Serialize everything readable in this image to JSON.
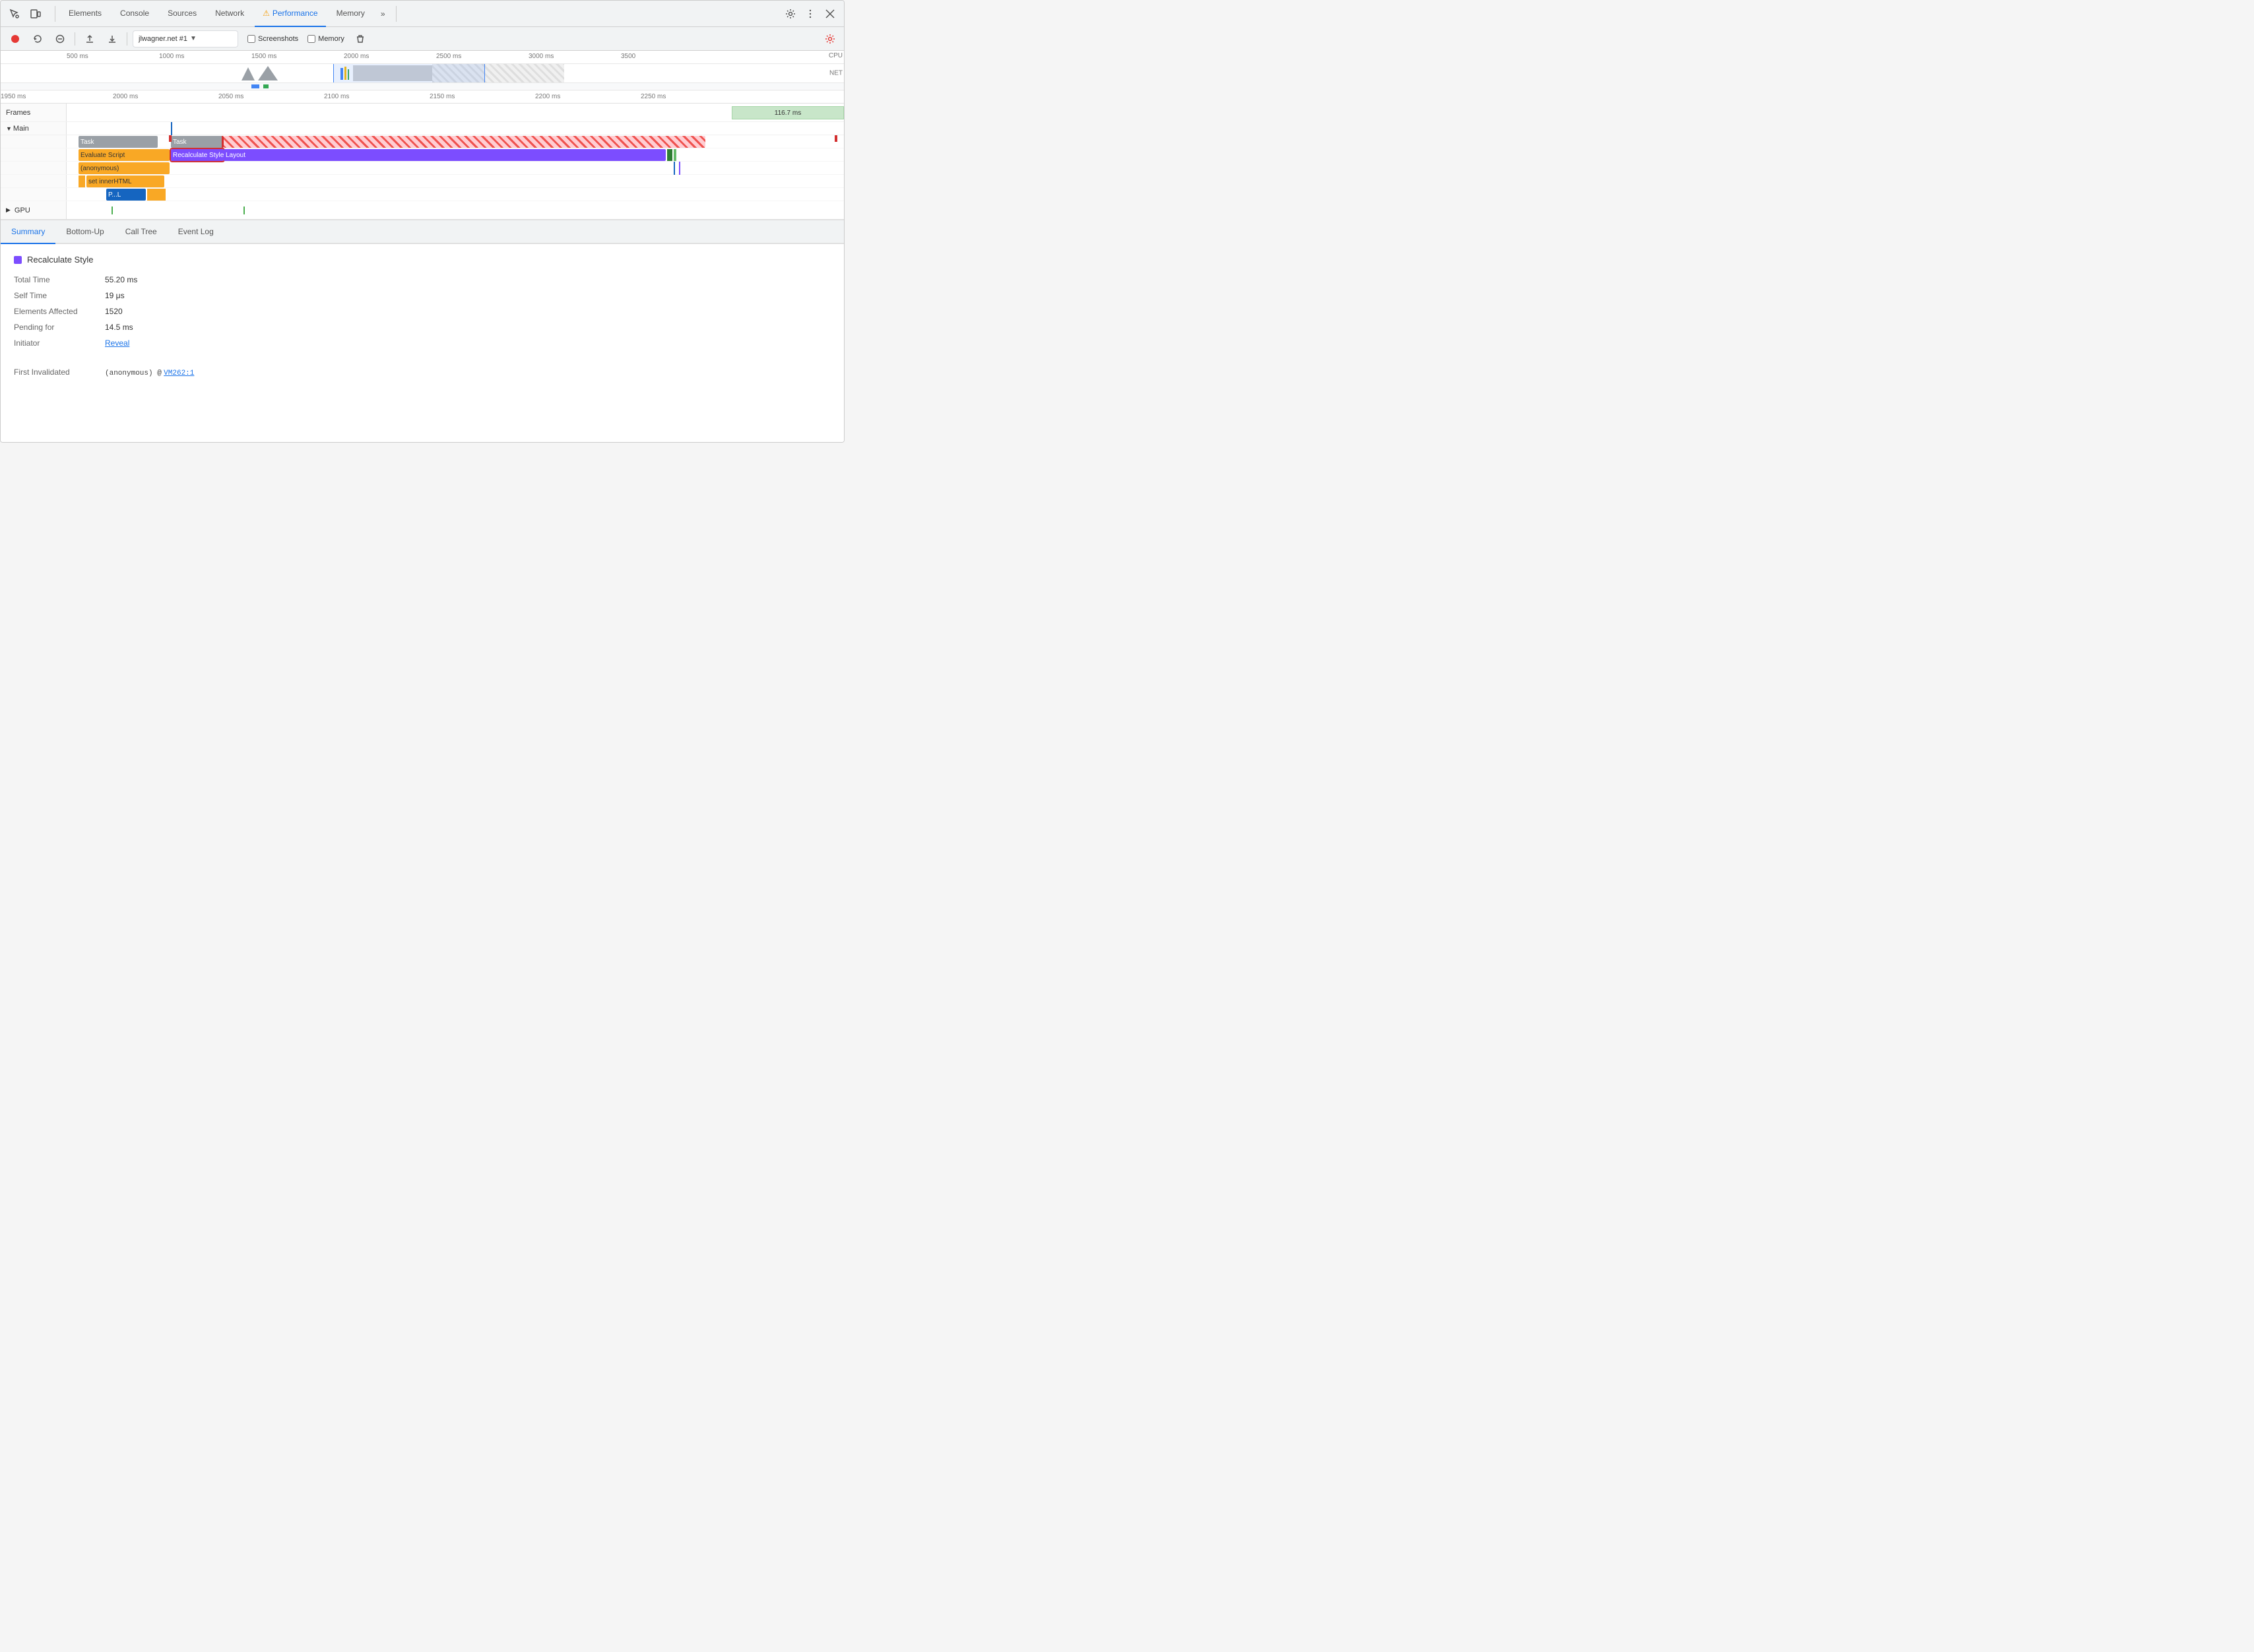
{
  "window": {
    "title": "Chrome DevTools"
  },
  "nav": {
    "tabs": [
      {
        "id": "elements",
        "label": "Elements",
        "active": false
      },
      {
        "id": "console",
        "label": "Console",
        "active": false
      },
      {
        "id": "sources",
        "label": "Sources",
        "active": false
      },
      {
        "id": "network",
        "label": "Network",
        "active": false
      },
      {
        "id": "performance",
        "label": "Performance",
        "active": true,
        "warn": true
      },
      {
        "id": "memory",
        "label": "Memory",
        "active": false
      }
    ],
    "more_label": "»"
  },
  "toolbar": {
    "url": "jlwagner.net #1",
    "screenshots_label": "Screenshots",
    "memory_label": "Memory"
  },
  "overview": {
    "ruler_marks": [
      "500 ms",
      "1000 ms",
      "1500 ms",
      "2000 ms",
      "2500 ms",
      "3000 ms",
      "3500"
    ],
    "cpu_label": "CPU",
    "net_label": "NET"
  },
  "detail_ruler": {
    "marks": [
      "1950 ms",
      "2000 ms",
      "2050 ms",
      "2100 ms",
      "2150 ms",
      "2200 ms",
      "2250 ms"
    ]
  },
  "tracks": {
    "frames_label": "Frames",
    "frame_bar": "116.7 ms",
    "main_label": "Main",
    "gpu_label": "GPU"
  },
  "flame": {
    "task1_label": "Task",
    "task2_label": "Task",
    "evaluate_script_label": "Evaluate Script",
    "recalculate_style_label": "Recalculate Style",
    "layout_label": "Layout",
    "anonymous_label": "(anonymous)",
    "set_inner_html_label": "set innerHTML",
    "p_l_label": "P...L"
  },
  "bottom_tabs": {
    "summary": "Summary",
    "bottom_up": "Bottom-Up",
    "call_tree": "Call Tree",
    "event_log": "Event Log"
  },
  "summary": {
    "title": "Recalculate Style",
    "color": "#7c4dff",
    "total_time_label": "Total Time",
    "total_time_value": "55.20 ms",
    "self_time_label": "Self Time",
    "self_time_value": "19 μs",
    "elements_affected_label": "Elements Affected",
    "elements_affected_value": "1520",
    "pending_for_label": "Pending for",
    "pending_for_value": "14.5 ms",
    "initiator_label": "Initiator",
    "initiator_link": "Reveal",
    "first_invalidated_label": "First Invalidated",
    "first_invalidated_code": "(anonymous) @",
    "first_invalidated_link": "VM262:1"
  }
}
